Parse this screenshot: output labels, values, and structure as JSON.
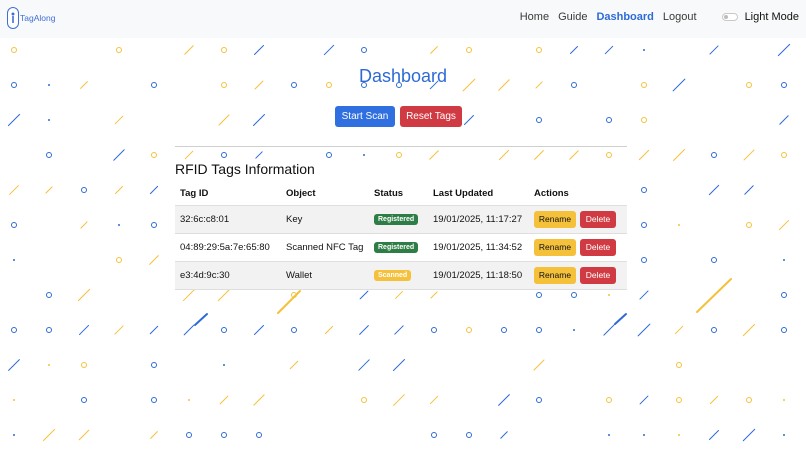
{
  "app": {
    "brand": "TagAlong"
  },
  "nav": {
    "links": [
      "Home",
      "Guide",
      "Dashboard",
      "Logout"
    ],
    "active": "Dashboard",
    "mode_label": "Light Mode"
  },
  "page": {
    "title": "Dashboard",
    "start_scan": "Start Scan",
    "reset_tags": "Reset Tags",
    "section_title": "RFID Tags Information"
  },
  "table": {
    "headers": [
      "Tag ID",
      "Object",
      "Status",
      "Last Updated",
      "Actions"
    ],
    "rows": [
      {
        "tag_id": "32:6c:c8:01",
        "object": "Key",
        "status": "Registered",
        "last_updated": "19/01/2025, 11:17:27"
      },
      {
        "tag_id": "04:89:29:5a:7e:65:80",
        "object": "Scanned NFC Tag",
        "status": "Registered",
        "last_updated": "19/01/2025, 11:34:52"
      },
      {
        "tag_id": "e3:4d:9c:30",
        "object": "Wallet",
        "status": "Scanned",
        "last_updated": "19/01/2025, 11:18:50"
      }
    ],
    "rename_label": "Rename",
    "delete_label": "Delete"
  },
  "colors": {
    "accent": "#2e6ad6",
    "danger": "#d03b43",
    "warning": "#f5c13b",
    "success": "#2f7d46"
  }
}
